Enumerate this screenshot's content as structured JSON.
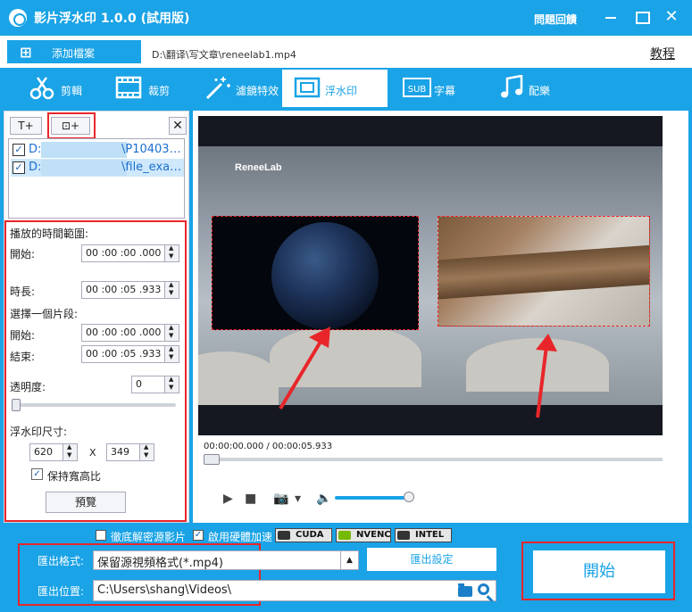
{
  "window": {
    "title": "影片浮水印 1.0.0 (試用版)",
    "help": "問題回饋"
  },
  "pathbar": {
    "add_file": "添加檔案",
    "file_path": "D:\\翻译\\写文章\\reneelab1.mp4",
    "tutorial": "教程"
  },
  "tabs": [
    {
      "label": "剪輯",
      "icon": "scissors-icon"
    },
    {
      "label": "裁剪",
      "icon": "crop-film-icon"
    },
    {
      "label": "濾鏡特效",
      "icon": "magic-wand-icon"
    },
    {
      "label": "浮水印",
      "icon": "watermark-frame-icon",
      "active": true
    },
    {
      "label": "字幕",
      "icon": "subtitle-icon"
    },
    {
      "label": "配樂",
      "icon": "music-note-icon"
    }
  ],
  "left": {
    "add_text_btn": "T+",
    "add_image_btn": "⊡+",
    "files": [
      {
        "prefix": "D:",
        "suffix": "\\P10403…",
        "checked": true
      },
      {
        "prefix": "D:",
        "suffix": "\\file_exa…",
        "checked": true
      }
    ],
    "time_range_label": "播放的時間範圍:",
    "start_label": "開始:",
    "start_value": "00 :00 :00 .000",
    "duration_label": "時長:",
    "duration_value": "00 :00 :05 .933",
    "segment_label": "選擇一個片段:",
    "seg_start_label": "開始:",
    "seg_start_value": "00 :00 :00 .000",
    "seg_end_label": "結束:",
    "seg_end_value": "00 :00 :05 .933",
    "opacity_label": "透明度:",
    "opacity_value": "0",
    "size_label": "浮水印尺寸:",
    "width_value": "620",
    "x_sep": "X",
    "height_value": "349",
    "keep_ratio_label": "保持寬高比",
    "keep_ratio": true,
    "preview_btn": "預覽"
  },
  "player": {
    "brand": "ReneeLab",
    "time": "00:00:00.000 / 00:00:05.933",
    "play": "▶",
    "stop": "■",
    "camera": "📷",
    "dropdown": "▾",
    "volume": "🔈",
    "progress": 0,
    "volume_level": 0.92
  },
  "bottom": {
    "opt1": "徹底解密源影片",
    "opt1_checked": false,
    "opt2": "啟用硬體加速",
    "opt2_checked": true,
    "badges": [
      "CUDA",
      "NVENC",
      "INTEL"
    ],
    "format_label": "匯出格式:",
    "format_value": "保留源視頻格式(*.mp4)",
    "settings_btn": "匯出設定",
    "location_label": "匯出位置:",
    "location_value": "C:\\Users\\shang\\Videos\\",
    "start_btn": "開始"
  },
  "colors": {
    "accent": "#1aa3e6",
    "highlight": "#e8262a"
  }
}
